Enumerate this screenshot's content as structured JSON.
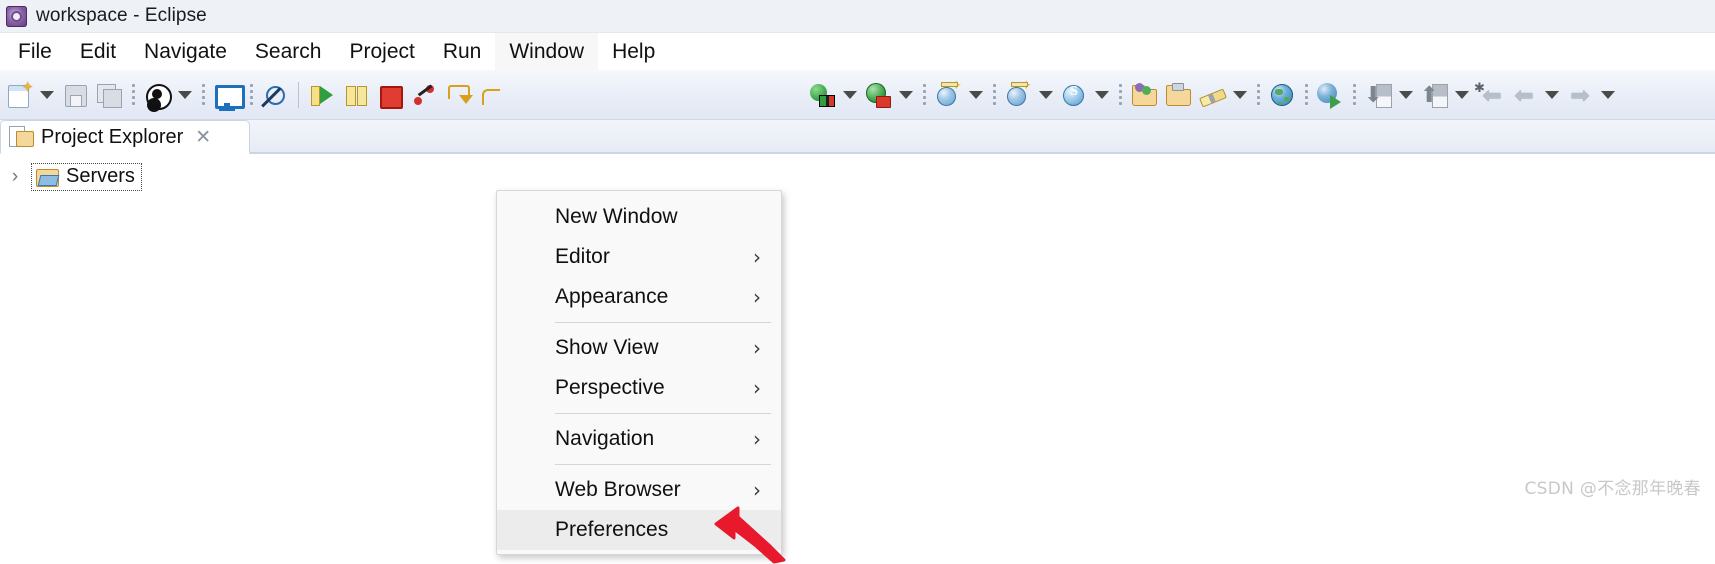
{
  "window": {
    "title": "workspace - Eclipse",
    "app_icon": "eclipse-logo-icon"
  },
  "menubar": {
    "items": [
      {
        "label": "File",
        "name": "menu-file",
        "active": false
      },
      {
        "label": "Edit",
        "name": "menu-edit",
        "active": false
      },
      {
        "label": "Navigate",
        "name": "menu-navigate",
        "active": false
      },
      {
        "label": "Search",
        "name": "menu-search",
        "active": false
      },
      {
        "label": "Project",
        "name": "menu-project",
        "active": false
      },
      {
        "label": "Run",
        "name": "menu-run",
        "active": false
      },
      {
        "label": "Window",
        "name": "menu-window",
        "active": true
      },
      {
        "label": "Help",
        "name": "menu-help",
        "active": false
      }
    ],
    "active_menu": "Window"
  },
  "window_menu": {
    "open": true,
    "items": [
      {
        "label": "New Window",
        "submenu": false,
        "highlighted": false
      },
      {
        "label": "Editor",
        "submenu": true,
        "highlighted": false
      },
      {
        "label": "Appearance",
        "submenu": true,
        "highlighted": false
      },
      {
        "separator_after": true
      },
      {
        "label": "Show View",
        "submenu": true,
        "highlighted": false
      },
      {
        "label": "Perspective",
        "submenu": true,
        "highlighted": false
      },
      {
        "separator_after": true
      },
      {
        "label": "Navigation",
        "submenu": true,
        "highlighted": false
      },
      {
        "separator_after": true
      },
      {
        "label": "Web Browser",
        "submenu": true,
        "highlighted": false
      },
      {
        "label": "Preferences",
        "submenu": false,
        "highlighted": true
      }
    ],
    "submenu_glyph": "›",
    "highlighted_item": "Preferences"
  },
  "toolbar": {
    "groups": [
      {
        "buttons": [
          {
            "icon": "new-wizard-icon",
            "dropdown": true
          },
          {
            "icon": "save-icon",
            "dropdown": false
          },
          {
            "icon": "save-all-icon",
            "dropdown": false
          }
        ],
        "dots_after": true
      },
      {
        "buttons": [
          {
            "icon": "user-account-icon",
            "dropdown": true
          }
        ],
        "dots_after": true
      },
      {
        "buttons": [
          {
            "icon": "open-console-icon",
            "dropdown": false
          }
        ],
        "dots_after": true
      },
      {
        "buttons": [
          {
            "icon": "skip-breakpoints-icon",
            "dropdown": false
          }
        ],
        "separator_after": true
      },
      {
        "buttons": [
          {
            "icon": "run-icon",
            "dropdown": false
          },
          {
            "icon": "pause-icon",
            "dropdown": false
          },
          {
            "icon": "stop-icon",
            "dropdown": false
          },
          {
            "icon": "step-graph-icon",
            "dropdown": false
          },
          {
            "icon": "step-return-icon",
            "dropdown": false
          },
          {
            "icon": "step-into-icon",
            "dropdown": false
          }
        ]
      },
      {
        "buttons": [
          {
            "icon": "run-server-icon",
            "dropdown": true
          },
          {
            "icon": "debug-server-icon",
            "dropdown": true
          }
        ],
        "dots_after": true
      },
      {
        "buttons": [
          {
            "icon": "new-web-project-icon",
            "dropdown": true
          },
          {
            "icon": "new-web-service-icon",
            "dropdown": true
          }
        ],
        "dots_after": true
      },
      {
        "buttons": [
          {
            "icon": "spring-bean-icon",
            "dropdown": true
          }
        ],
        "dots_after": true
      },
      {
        "buttons": [
          {
            "icon": "open-type-folder-icon",
            "dropdown": false
          },
          {
            "icon": "open-resource-folder-icon",
            "dropdown": false
          },
          {
            "icon": "pencil-edit-icon",
            "dropdown": true
          }
        ],
        "dots_after": true
      },
      {
        "buttons": [
          {
            "icon": "globe-icon",
            "dropdown": false
          }
        ],
        "dots_after": true
      },
      {
        "buttons": [
          {
            "icon": "globe-run-icon",
            "dropdown": false
          }
        ],
        "dots_after": true
      },
      {
        "buttons": [
          {
            "icon": "import-icon",
            "dropdown": true
          },
          {
            "icon": "export-icon",
            "dropdown": true
          },
          {
            "icon": "last-edit-location-icon",
            "dropdown": false
          },
          {
            "icon": "back-arrow-icon",
            "dropdown": true
          },
          {
            "icon": "forward-arrow-icon",
            "dropdown": true
          }
        ]
      }
    ]
  },
  "view": {
    "tab": {
      "label": "Project Explorer",
      "icon": "project-explorer-icon",
      "close_glyph": "✕"
    },
    "tree": {
      "expander_glyph": "›",
      "items": [
        {
          "label": "Servers",
          "icon": "servers-folder-icon",
          "expanded": false,
          "selected": true
        }
      ]
    }
  },
  "annotation": {
    "arrow": "red-annotation-arrow",
    "color": "#e8192c",
    "points_to": "Preferences"
  },
  "watermark": {
    "text": "CSDN @不念那年晚春",
    "color": "#c8c8c8"
  }
}
